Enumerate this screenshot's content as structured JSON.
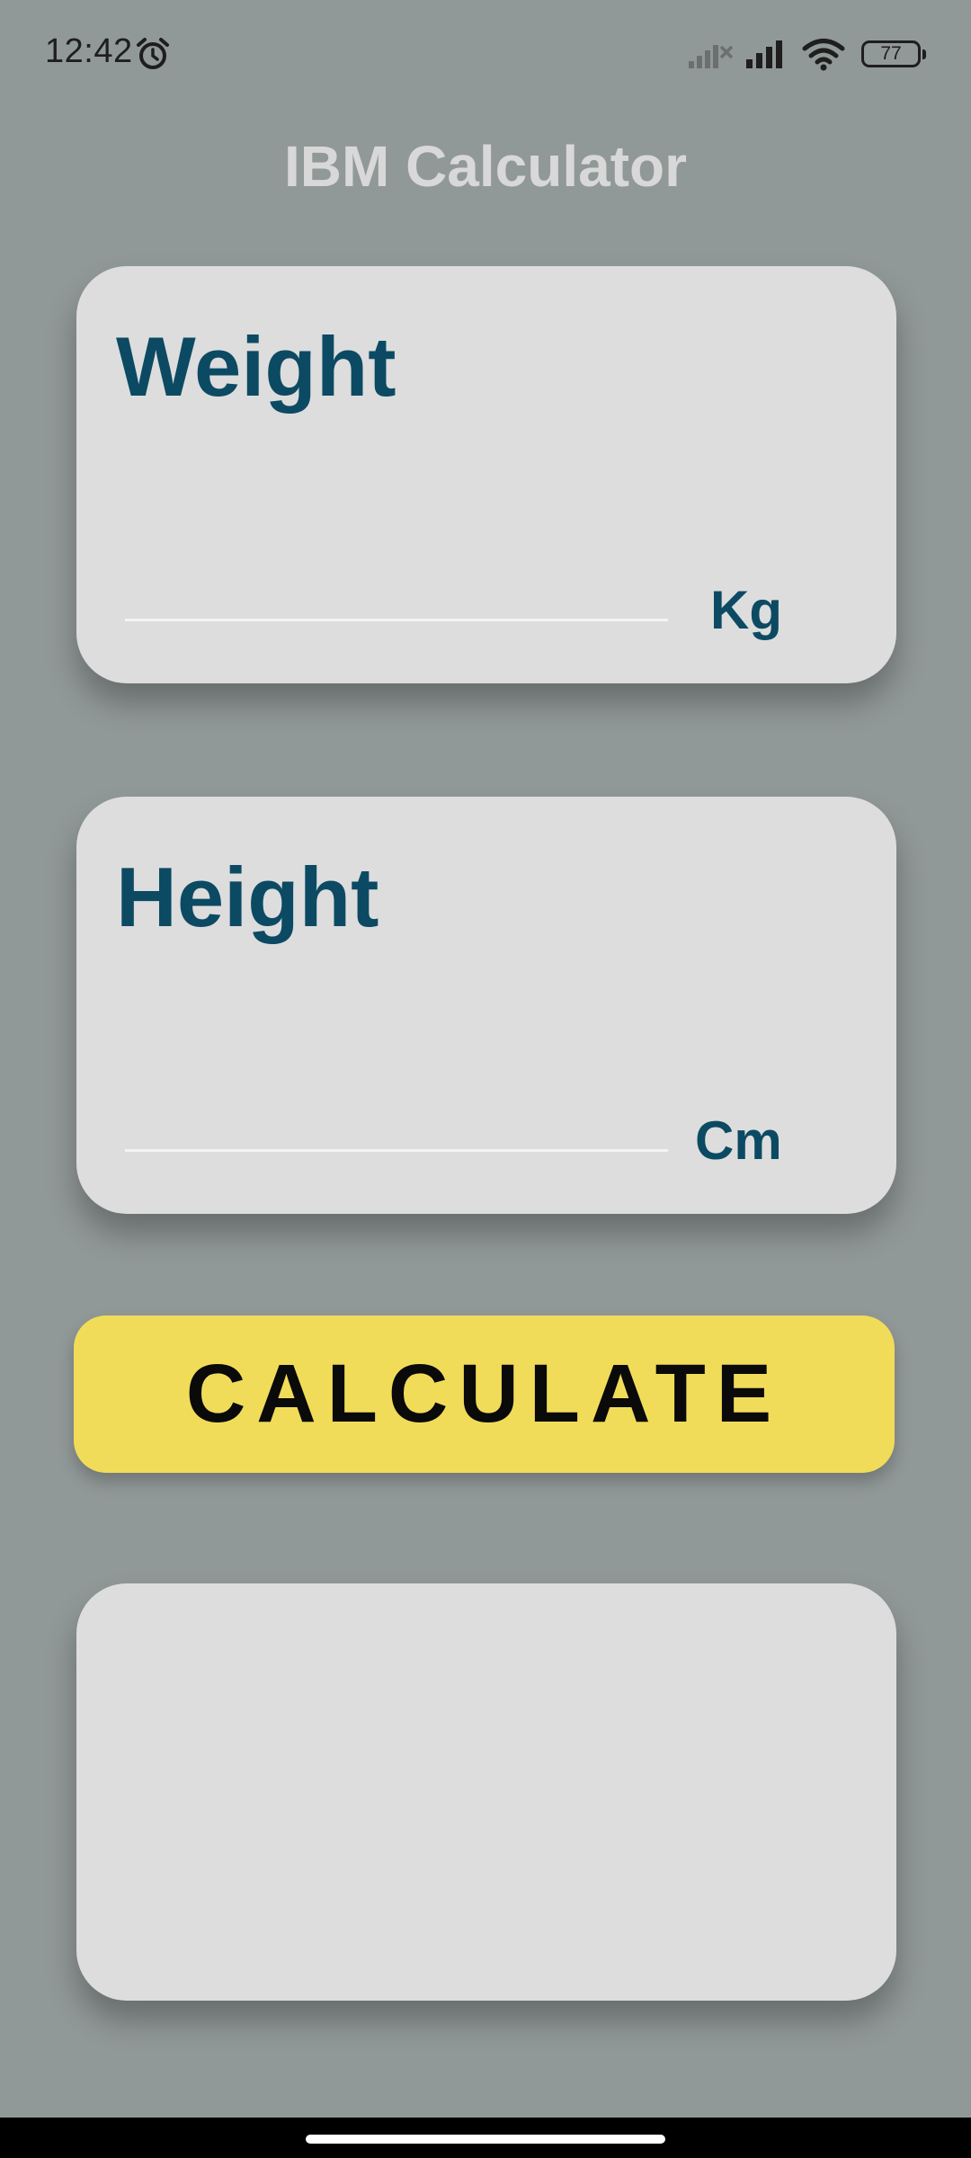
{
  "status_bar": {
    "time": "12:42",
    "battery": "77",
    "icons": [
      "alarm-icon",
      "no-signal-icon",
      "signal-icon",
      "wifi-icon",
      "battery-icon"
    ]
  },
  "app": {
    "title": "IBM Calculator"
  },
  "weight_card": {
    "label": "Weight",
    "value": "",
    "unit": "Kg"
  },
  "height_card": {
    "label": "Height",
    "value": "",
    "unit": "Cm"
  },
  "calculate_button": {
    "label": "CALCULATE"
  },
  "result_card": {
    "text": ""
  },
  "colors": {
    "background": "#919898",
    "card": "#dddddd",
    "label": "#0c4a63",
    "button": "#f1dc5a",
    "title": "#d8d8d8"
  }
}
